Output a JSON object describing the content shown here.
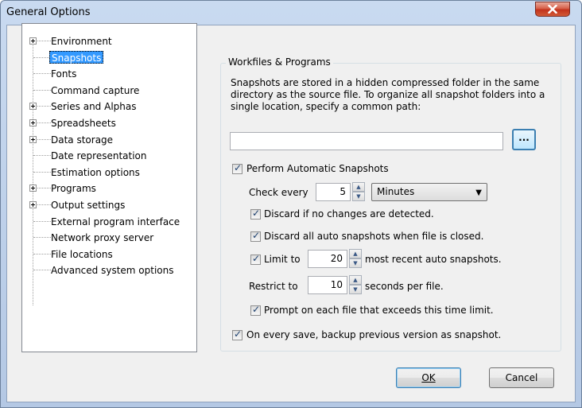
{
  "window": {
    "title": "General Options",
    "close_glyph": "X"
  },
  "tree": {
    "items": [
      {
        "label": "Environment",
        "expandable": true,
        "selected": false
      },
      {
        "label": "Snapshots",
        "expandable": false,
        "selected": true
      },
      {
        "label": "Fonts",
        "expandable": false,
        "selected": false
      },
      {
        "label": "Command capture",
        "expandable": false,
        "selected": false
      },
      {
        "label": "Series and Alphas",
        "expandable": true,
        "selected": false
      },
      {
        "label": "Spreadsheets",
        "expandable": true,
        "selected": false
      },
      {
        "label": "Data storage",
        "expandable": true,
        "selected": false
      },
      {
        "label": "Date representation",
        "expandable": false,
        "selected": false
      },
      {
        "label": "Estimation options",
        "expandable": false,
        "selected": false
      },
      {
        "label": "Programs",
        "expandable": true,
        "selected": false
      },
      {
        "label": "Output settings",
        "expandable": true,
        "selected": false
      },
      {
        "label": "External program interface",
        "expandable": false,
        "selected": false
      },
      {
        "label": "Network proxy server",
        "expandable": false,
        "selected": false
      },
      {
        "label": "File locations",
        "expandable": false,
        "selected": false
      },
      {
        "label": "Advanced system options",
        "expandable": false,
        "selected": false
      }
    ]
  },
  "panel": {
    "group_title": "Workfiles & Programs",
    "description": "Snapshots are stored in a hidden compressed folder in the same directory as the source file.  To organize all snapshot folders into a single location, specify a common path:",
    "path_value": "",
    "browse_label": "...",
    "perform_auto": {
      "label": "Perform Automatic Snapshots",
      "checked": true
    },
    "check_every": {
      "label": "Check every",
      "value": "5",
      "unit": "Minutes"
    },
    "discard_no_changes": {
      "label": "Discard if no changes are detected.",
      "checked": true
    },
    "discard_on_close": {
      "label": "Discard all auto snapshots when file is closed.",
      "checked": true
    },
    "limit": {
      "label": "Limit to",
      "checked": true,
      "value": "20",
      "suffix": "most recent auto snapshots."
    },
    "restrict": {
      "label": "Restrict to",
      "value": "10",
      "suffix": "seconds per file."
    },
    "prompt_exceed": {
      "label": "Prompt on each file that exceeds this time limit.",
      "checked": true
    },
    "backup_on_save": {
      "label": "On every save, backup previous version as snapshot.",
      "checked": true
    }
  },
  "buttons": {
    "ok": "OK",
    "cancel": "Cancel"
  },
  "glyphs": {
    "check": "✓",
    "spin_up": "▲",
    "spin_down": "▼",
    "dropdown": "▼"
  },
  "colors": {
    "selection": "#3399ff",
    "close_button": "#c2321c"
  }
}
